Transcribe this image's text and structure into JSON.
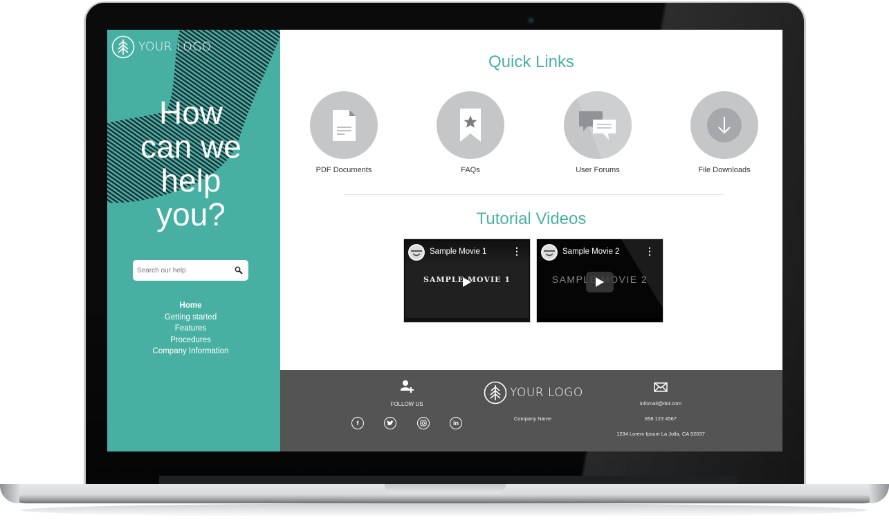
{
  "sidebar": {
    "logo_text": "YOUR LOGO",
    "hero_lines": [
      "How",
      "can we",
      "help",
      "you?"
    ],
    "search": {
      "placeholder": "Search our help",
      "value": ""
    },
    "nav": [
      {
        "label": "Home",
        "active": true
      },
      {
        "label": "Getting started",
        "active": false
      },
      {
        "label": "Features",
        "active": false
      },
      {
        "label": "Procedures",
        "active": false
      },
      {
        "label": "Company Information",
        "active": false
      }
    ]
  },
  "main": {
    "quick_links_title": "Quick Links",
    "quick_links": [
      {
        "label": "PDF Documents",
        "icon": "document-icon"
      },
      {
        "label": "FAQs",
        "icon": "bookmark-star-icon"
      },
      {
        "label": "User Forums",
        "icon": "chat-bubbles-icon"
      },
      {
        "label": "File Downloads",
        "icon": "download-arrow-icon"
      }
    ],
    "tutorial_title": "Tutorial Videos",
    "videos": [
      {
        "title": "Sample Movie 1",
        "watermark": "SAMPLE MOVIE 1"
      },
      {
        "title": "Sample Movie 2",
        "watermark": "SAMPLE MOVIE 2"
      }
    ]
  },
  "footer": {
    "follow_label": "FOLLOW US",
    "socials": [
      "facebook",
      "twitter",
      "instagram",
      "linkedin"
    ],
    "logo_text": "YOUR LOGO",
    "company_name": "Company Name",
    "email": "infomail@dot.com",
    "phone": "858 123 4567",
    "address": "1234 Lorem Ipsum La Jolla, CA 92037"
  },
  "colors": {
    "accent": "#48b0a3",
    "footer_bg": "#545454",
    "icon_circle": "#c4c6c8"
  }
}
